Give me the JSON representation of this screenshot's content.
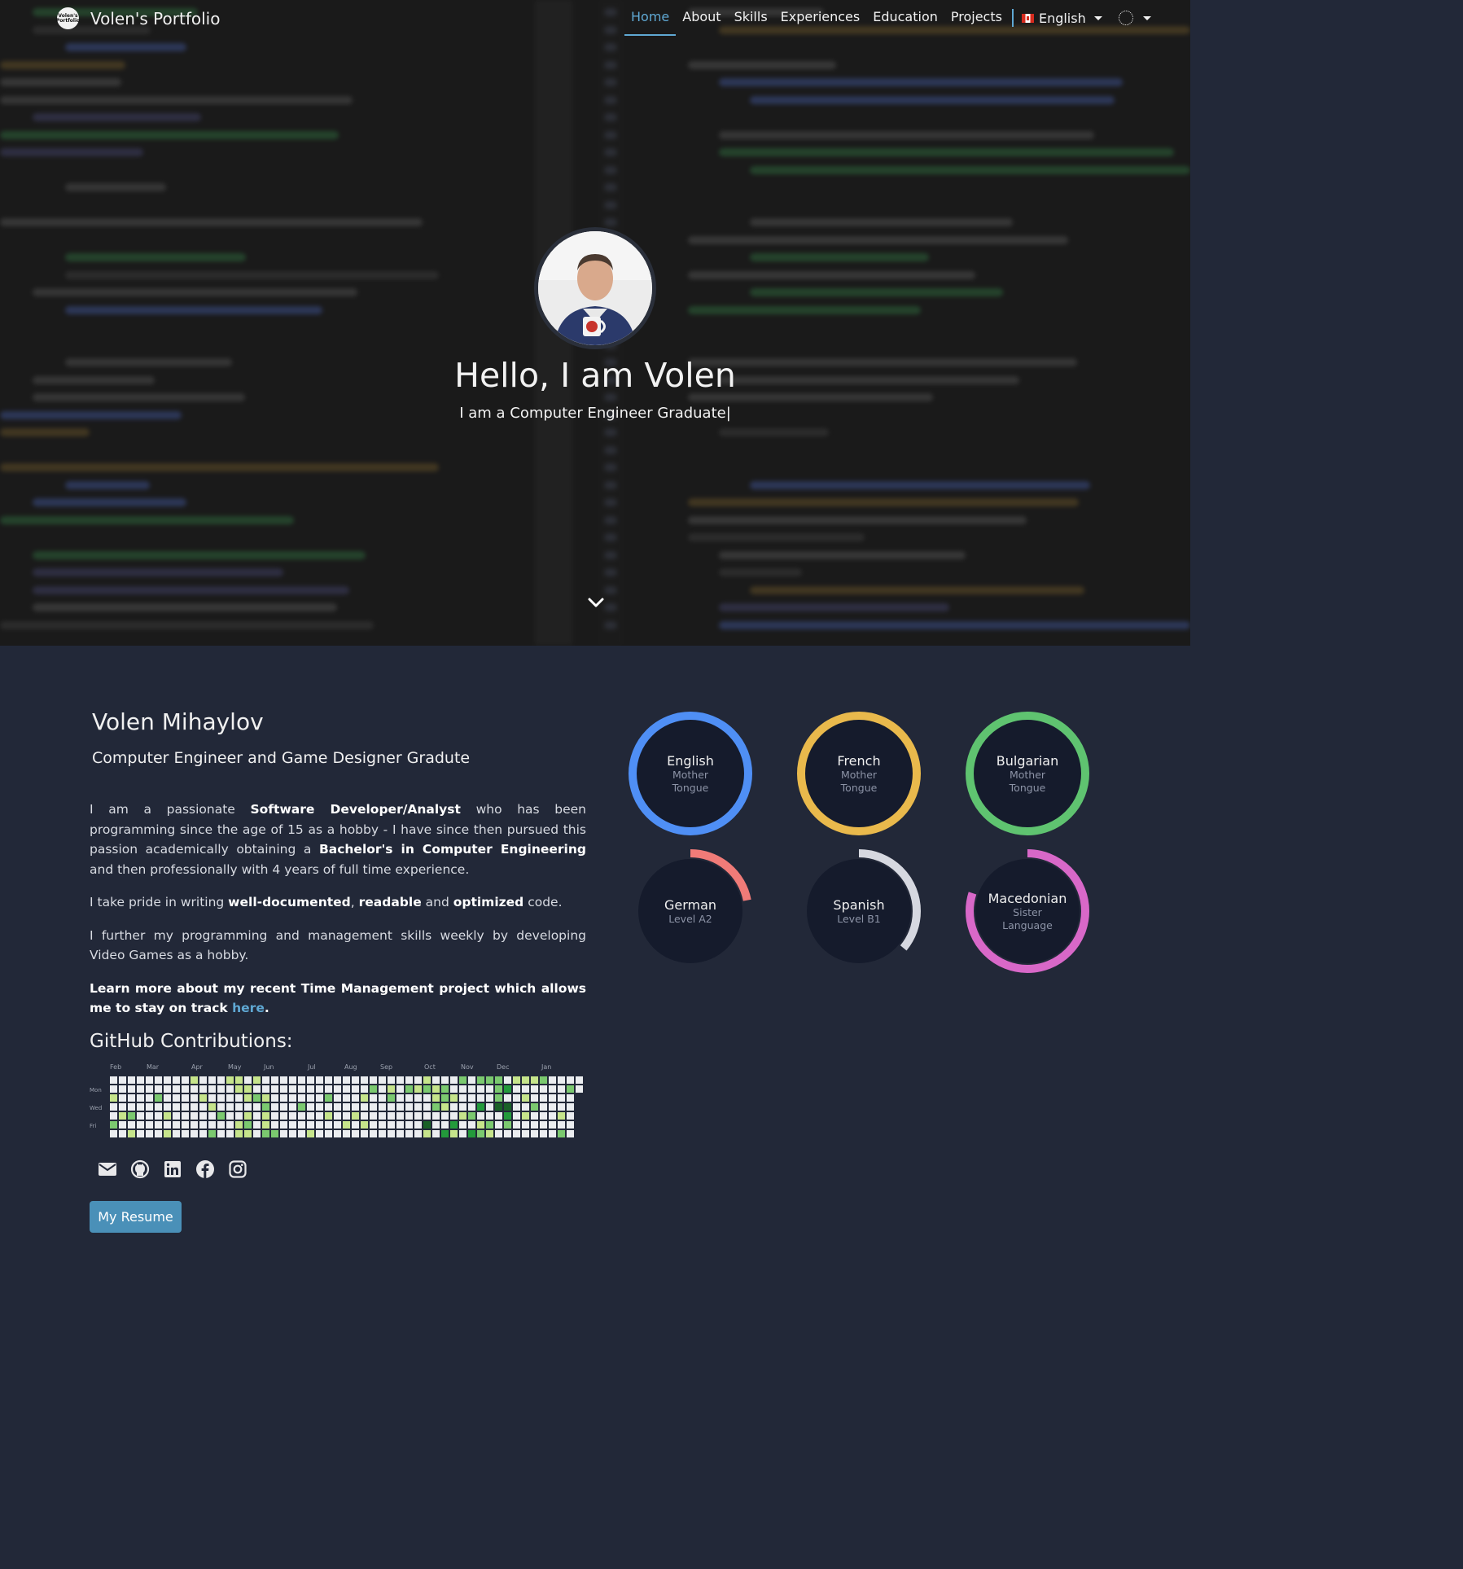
{
  "nav": {
    "brand_logo_text": "Volen's Portfolio",
    "brand": "Volen's Portfolio",
    "links": [
      "Home",
      "About",
      "Skills",
      "Experiences",
      "Education",
      "Projects"
    ],
    "active": "Home",
    "language": "English"
  },
  "hero": {
    "greeting": "Hello, I am Volen",
    "tagline": "I am a Computer Engineer Graduate|"
  },
  "about": {
    "name": "Volen Mihaylov",
    "subtitle": "Computer Engineer and Game Designer Gradute",
    "p1_a": "I am a passionate ",
    "p1_b": "Software Developer/Analyst",
    "p1_c": " who has been programming since the age of 15 as a hobby - I have since then pursued this passion academically obtaining a ",
    "p1_d": "Bachelor's in Computer Engineering",
    "p1_e": " and then professionally with 4 years of full time experience.",
    "p2_a": "I take pride in writing ",
    "p2_b": "well-documented",
    "p2_c": ", ",
    "p2_d": "readable",
    "p2_e": " and ",
    "p2_f": "optimized",
    "p2_g": " code.",
    "p3": "I further my programming and management skills weekly by developing Video Games as a hobby.",
    "p4_a": "Learn more about my recent Time Management project which allows me to stay on track ",
    "p4_link": "here",
    "p4_end": ".",
    "github_title": "GitHub Contributions:",
    "resume_button": "My Resume"
  },
  "github": {
    "months": [
      "Feb",
      "Mar",
      "Apr",
      "May",
      "Jun",
      "Jul",
      "Aug",
      "Sep",
      "Oct",
      "Nov",
      "Dec",
      "Jan"
    ],
    "days": [
      "Mon",
      "Wed",
      "Fri"
    ],
    "colors": [
      "#ebedf0",
      "#c6e48b",
      "#7bc96f",
      "#239a3b",
      "#196127"
    ]
  },
  "socials": [
    "email-icon",
    "github-icon",
    "linkedin-icon",
    "facebook-icon",
    "instagram-icon"
  ],
  "languages": [
    {
      "name": "English",
      "level": "Mother Tongue",
      "percent": 100,
      "color": "#4f8ff5"
    },
    {
      "name": "French",
      "level": "Mother Tongue",
      "percent": 100,
      "color": "#e9b94c"
    },
    {
      "name": "Bulgarian",
      "level": "Mother Tongue",
      "percent": 100,
      "color": "#5fc370"
    },
    {
      "name": "German",
      "level": "Level A2",
      "percent": 22,
      "color": "#f07b78"
    },
    {
      "name": "Spanish",
      "level": "Level B1",
      "percent": 36,
      "color": "#d6d8e0"
    },
    {
      "name": "Macedonian",
      "level": "Sister Language",
      "percent": 80,
      "color": "#d868c8"
    }
  ]
}
